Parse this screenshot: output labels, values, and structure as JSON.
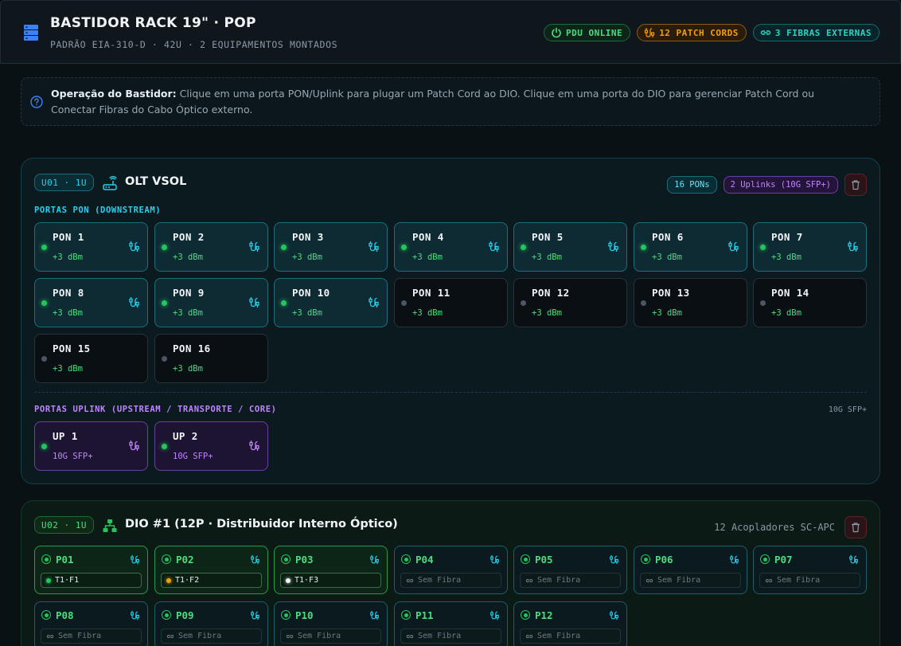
{
  "header": {
    "title": "BASTIDOR RACK 19\" · POP",
    "subtitle": "PADRÃO EIA-310-D · 42U · 2 EQUIPAMENTOS MONTADOS",
    "badges": {
      "pdu": "PDU ONLINE",
      "patch": "12 PATCH CORDS",
      "fibers": "3 FIBRAS EXTERNAS"
    }
  },
  "info": {
    "label": "Operação do Bastidor:",
    "text": "Clique em uma porta PON/Uplink para plugar um Patch Cord ao DIO. Clique em uma porta do DIO para gerenciar Patch Cord ou Conectar Fibras do Cabo Óptico externo."
  },
  "olt": {
    "unit": "U01 · 1U",
    "title": "OLT VSOL",
    "pons_chip": "16 PONs",
    "uplinks_chip": "2 Uplinks (10G SFP+)",
    "pon_label": "PORTAS PON (DOWNSTREAM)",
    "uplink_label": "PORTAS UPLINK (UPSTREAM / TRANSPORTE / CORE)",
    "uplink_speed": "10G SFP+",
    "pon_ports": [
      {
        "name": "PON 1",
        "power": "+3 dBm",
        "active": true
      },
      {
        "name": "PON 2",
        "power": "+3 dBm",
        "active": true
      },
      {
        "name": "PON 3",
        "power": "+3 dBm",
        "active": true
      },
      {
        "name": "PON 4",
        "power": "+3 dBm",
        "active": true
      },
      {
        "name": "PON 5",
        "power": "+3 dBm",
        "active": true
      },
      {
        "name": "PON 6",
        "power": "+3 dBm",
        "active": true
      },
      {
        "name": "PON 7",
        "power": "+3 dBm",
        "active": true
      },
      {
        "name": "PON 8",
        "power": "+3 dBm",
        "active": true
      },
      {
        "name": "PON 9",
        "power": "+3 dBm",
        "active": true
      },
      {
        "name": "PON 10",
        "power": "+3 dBm",
        "active": true
      },
      {
        "name": "PON 11",
        "power": "+3 dBm",
        "active": false
      },
      {
        "name": "PON 12",
        "power": "+3 dBm",
        "active": false
      },
      {
        "name": "PON 13",
        "power": "+3 dBm",
        "active": false
      },
      {
        "name": "PON 14",
        "power": "+3 dBm",
        "active": false
      },
      {
        "name": "PON 15",
        "power": "+3 dBm",
        "active": false
      },
      {
        "name": "PON 16",
        "power": "+3 dBm",
        "active": false
      }
    ],
    "uplink_ports": [
      {
        "name": "UP 1",
        "speed": "10G SFP+"
      },
      {
        "name": "UP 2",
        "speed": "10G SFP+"
      }
    ]
  },
  "dio": {
    "unit": "U02 · 1U",
    "title": "DIO #1 (12P · Distribuidor Interno Óptico)",
    "note": "12 Acopladores SC-APC",
    "empty_label": "Sem Fibra",
    "ports": [
      {
        "name": "P01",
        "fiber": "T1·F1",
        "fiber_color": "#22c55e"
      },
      {
        "name": "P02",
        "fiber": "T1·F2",
        "fiber_color": "#f59e0b"
      },
      {
        "name": "P03",
        "fiber": "T1·F3",
        "fiber_color": "#f1f5f9"
      },
      {
        "name": "P04",
        "fiber": ""
      },
      {
        "name": "P05",
        "fiber": ""
      },
      {
        "name": "P06",
        "fiber": ""
      },
      {
        "name": "P07",
        "fiber": ""
      },
      {
        "name": "P08",
        "fiber": ""
      },
      {
        "name": "P09",
        "fiber": ""
      },
      {
        "name": "P10",
        "fiber": ""
      },
      {
        "name": "P11",
        "fiber": ""
      },
      {
        "name": "P12",
        "fiber": ""
      }
    ]
  },
  "colors": {
    "accent_cyan": "#22d3ee",
    "accent_green": "#22c55e",
    "accent_purple": "#c084fc",
    "accent_orange": "#f59e0b"
  }
}
